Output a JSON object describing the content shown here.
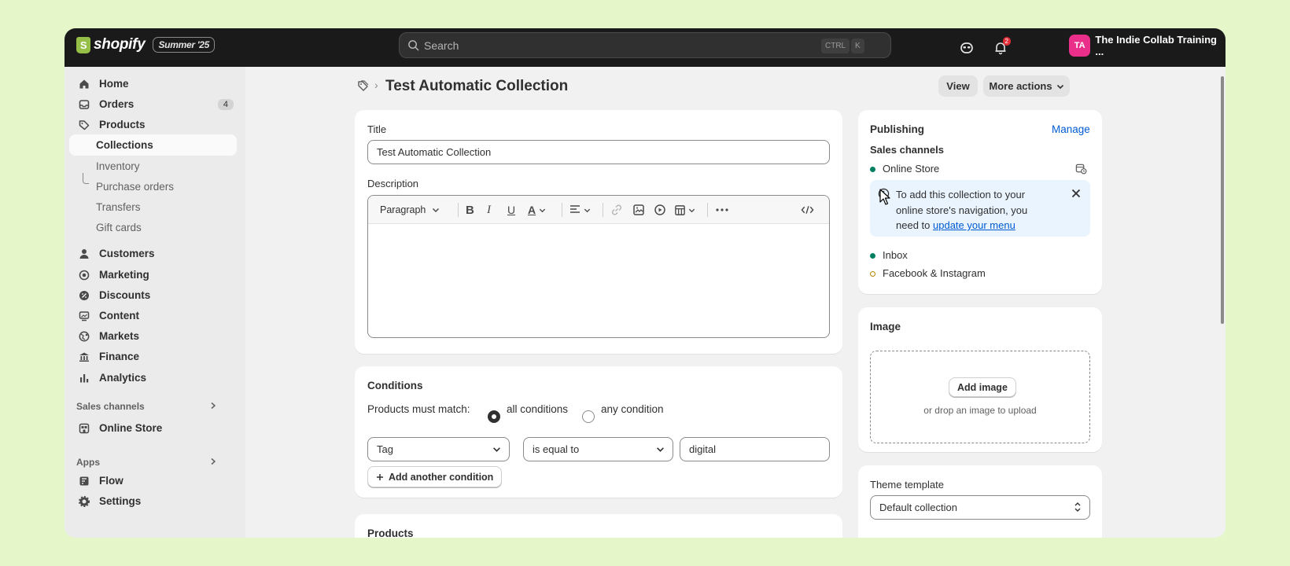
{
  "topbar": {
    "brand": "shopify",
    "edition": "Summer '25",
    "search_placeholder": "Search",
    "kbd_ctrl": "CTRL",
    "kbd_k": "K",
    "notification_count": "2",
    "store_initials": "TA",
    "store_name": "The Indie Collab Training ..."
  },
  "sidebar": {
    "home": "Home",
    "orders": "Orders",
    "orders_count": "4",
    "products": "Products",
    "collections": "Collections",
    "inventory": "Inventory",
    "purchase_orders": "Purchase orders",
    "transfers": "Transfers",
    "gift_cards": "Gift cards",
    "customers": "Customers",
    "marketing": "Marketing",
    "discounts": "Discounts",
    "content": "Content",
    "markets": "Markets",
    "finance": "Finance",
    "analytics": "Analytics",
    "sales_channels_heading": "Sales channels",
    "online_store": "Online Store",
    "apps_heading": "Apps",
    "flow": "Flow",
    "settings": "Settings"
  },
  "header": {
    "title": "Test Automatic Collection",
    "view_label": "View",
    "more_actions_label": "More actions"
  },
  "details": {
    "title_label": "Title",
    "title_value": "Test Automatic Collection",
    "description_label": "Description",
    "paragraph_style": "Paragraph"
  },
  "conditions": {
    "heading": "Conditions",
    "match_label": "Products must match:",
    "all_label": "all conditions",
    "any_label": "any condition",
    "selected": "all conditions",
    "field": "Tag",
    "operator": "is equal to",
    "value": "digital",
    "add_label": "Add another condition"
  },
  "products": {
    "heading": "Products"
  },
  "publishing": {
    "heading": "Publishing",
    "manage_label": "Manage",
    "channels_label": "Sales channels",
    "channel_online_store": "Online Store",
    "banner_text": "To add this collection to your online store's navigation, you need to",
    "banner_link": "update your menu",
    "channel_inbox": "Inbox",
    "channel_facebook": "Facebook & Instagram"
  },
  "image": {
    "heading": "Image",
    "add_label": "Add image",
    "drop_hint": "or drop an image to upload"
  },
  "theme": {
    "heading": "Theme template",
    "value": "Default collection"
  },
  "colors": {
    "topbar": "#1a1a1a",
    "accent_green": "#008060",
    "link_blue": "#005bd3",
    "page_bg": "#e5f7c9"
  }
}
